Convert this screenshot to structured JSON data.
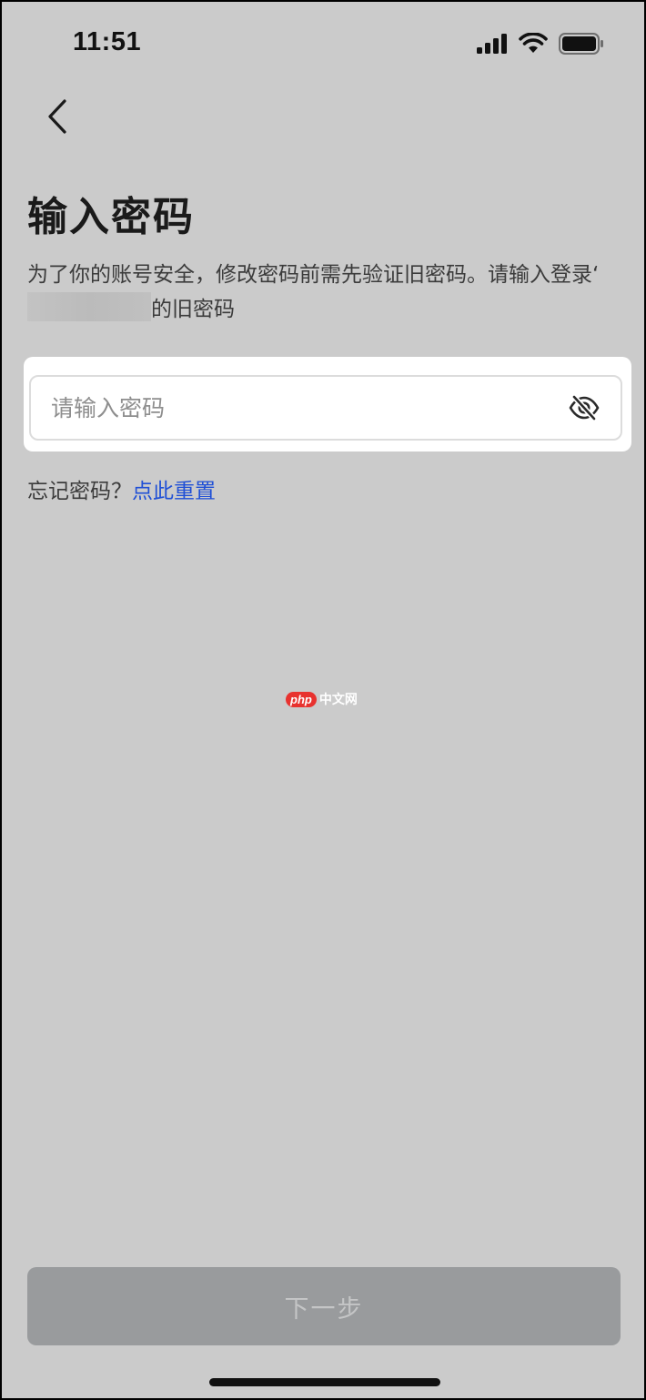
{
  "status_bar": {
    "time": "11:51",
    "icons": [
      "signal-icon",
      "wifi-icon",
      "battery-icon"
    ]
  },
  "nav": {
    "back_icon": "chevron-left-icon"
  },
  "page": {
    "title": "输入密码",
    "description_before": "为了你的账号安全，修改密码前需先验证旧密码。请输入登录‘",
    "description_after": "的旧密码"
  },
  "password_field": {
    "placeholder": "请输入密码",
    "value": "",
    "toggle_icon": "eye-off-icon"
  },
  "forgot": {
    "prompt": "忘记密码？",
    "link": "点此重置"
  },
  "watermark": {
    "badge": "php",
    "text": "中文网"
  },
  "footer": {
    "next_label": "下一步"
  },
  "colors": {
    "background": "#cbcbcb",
    "link": "#1f4fd6",
    "button_disabled": "#999b9d"
  }
}
